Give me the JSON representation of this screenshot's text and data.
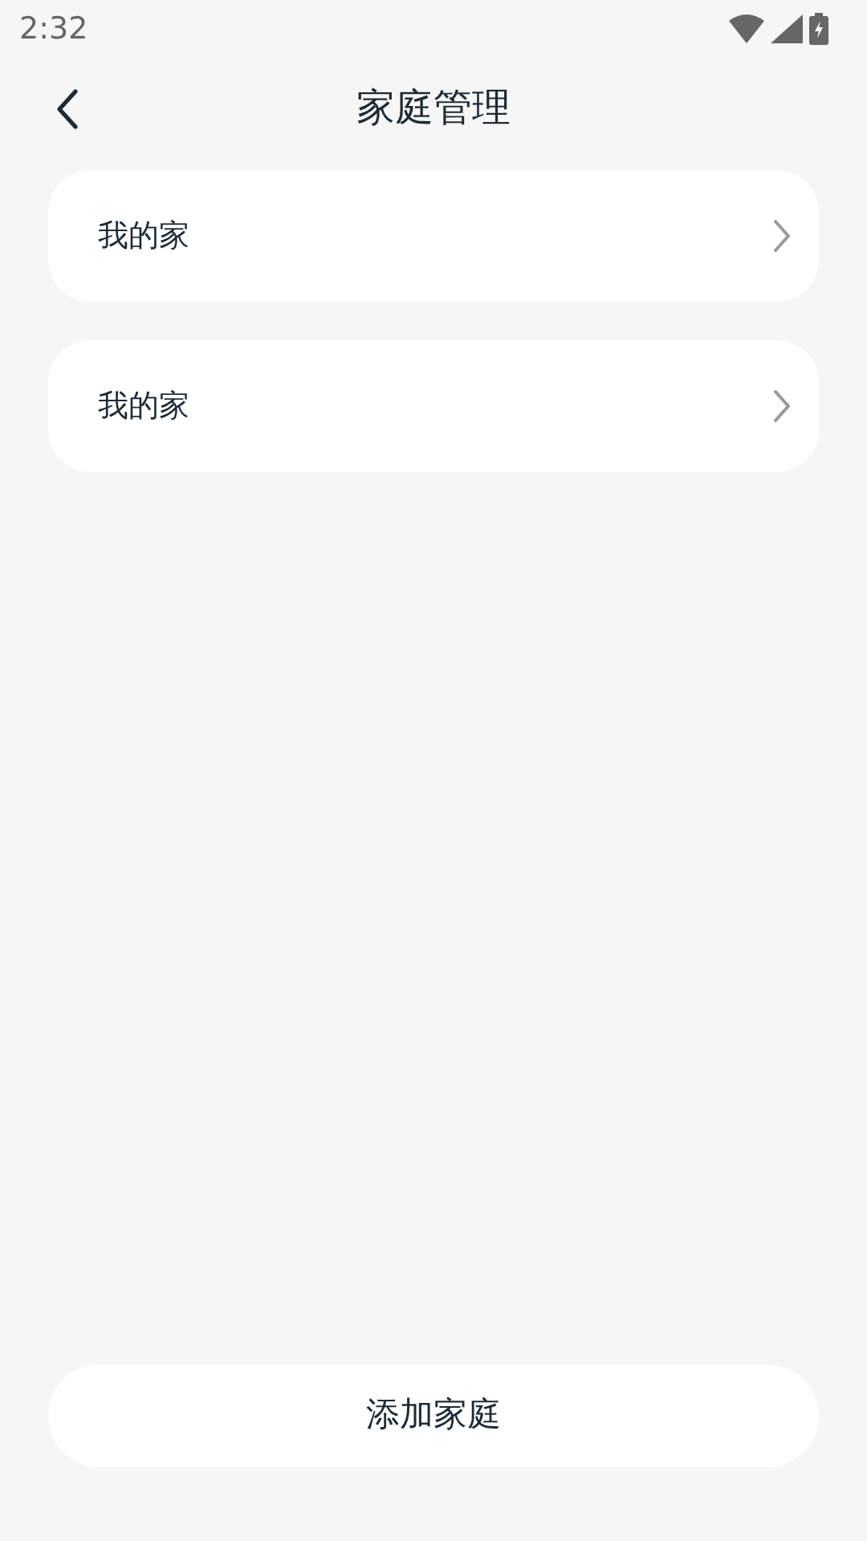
{
  "status_bar": {
    "time": "2:32"
  },
  "header": {
    "title": "家庭管理"
  },
  "homes": [
    {
      "name": "我的家"
    },
    {
      "name": "我的家"
    }
  ],
  "add_button": {
    "label": "添加家庭"
  }
}
